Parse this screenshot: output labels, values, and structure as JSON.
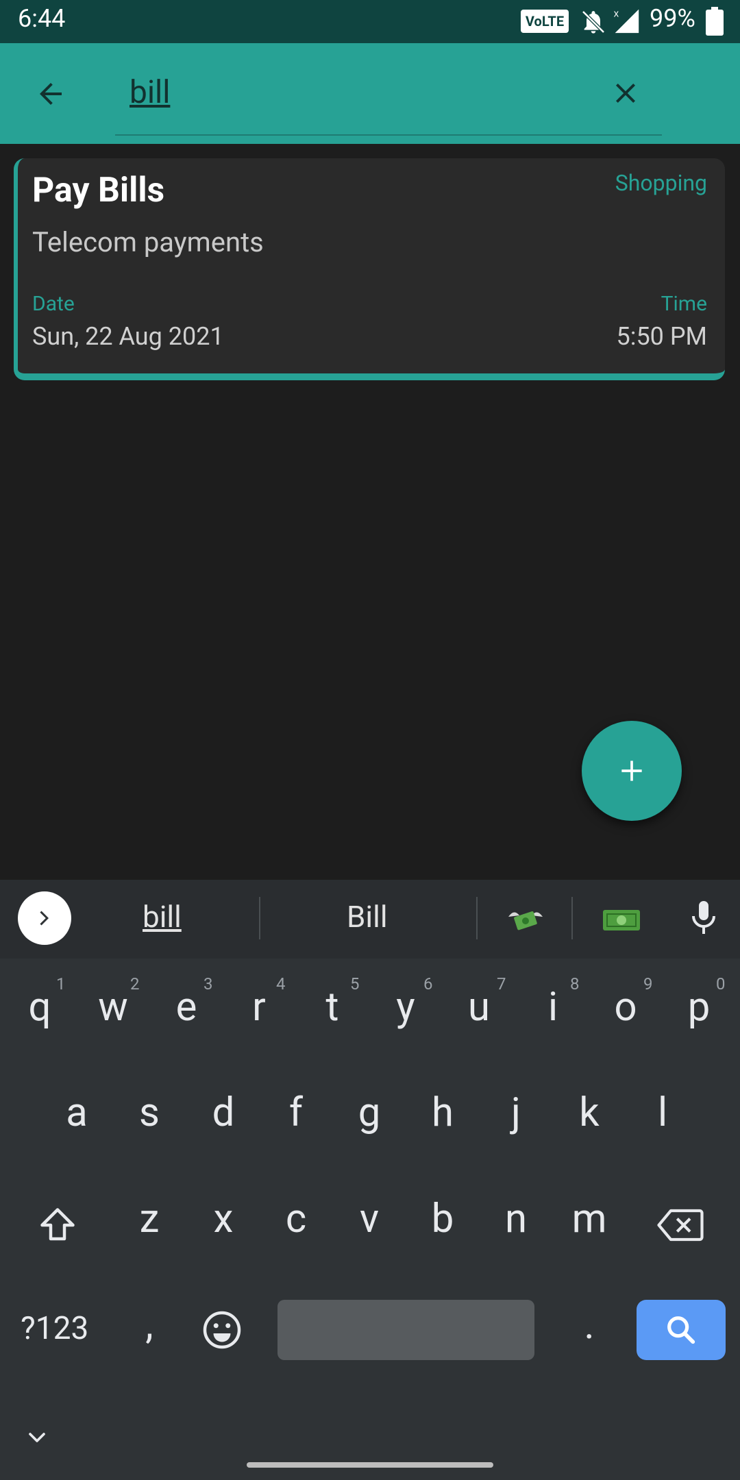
{
  "status_bar": {
    "time": "6:44",
    "network_badge": "VoLTE",
    "battery": "99%"
  },
  "search": {
    "query": "bill"
  },
  "card": {
    "title": "Pay Bills",
    "category": "Shopping",
    "description": "Telecom payments",
    "date_label": "Date",
    "date_value": "Sun, 22 Aug 2021",
    "time_label": "Time",
    "time_value": "5:50 PM"
  },
  "keyboard": {
    "suggestions": [
      "bill",
      "Bill"
    ],
    "emoji_suggestions": [
      "money-with-wings-icon",
      "dollar-banknote-icon"
    ],
    "row1": [
      "q",
      "w",
      "e",
      "r",
      "t",
      "y",
      "u",
      "i",
      "o",
      "p"
    ],
    "row1_numbers": [
      "1",
      "2",
      "3",
      "4",
      "5",
      "6",
      "7",
      "8",
      "9",
      "0"
    ],
    "row2": [
      "a",
      "s",
      "d",
      "f",
      "g",
      "h",
      "j",
      "k",
      "l"
    ],
    "row3": [
      "z",
      "x",
      "c",
      "v",
      "b",
      "n",
      "m"
    ],
    "symbols_key": "?123",
    "comma": ",",
    "period": "."
  },
  "colors": {
    "accent": "#27a295",
    "status_bar": "#0f4440",
    "background": "#1d1d1d",
    "card": "#2a2a2a",
    "keyboard": "#2f3336",
    "search_key": "#5b9af5"
  }
}
